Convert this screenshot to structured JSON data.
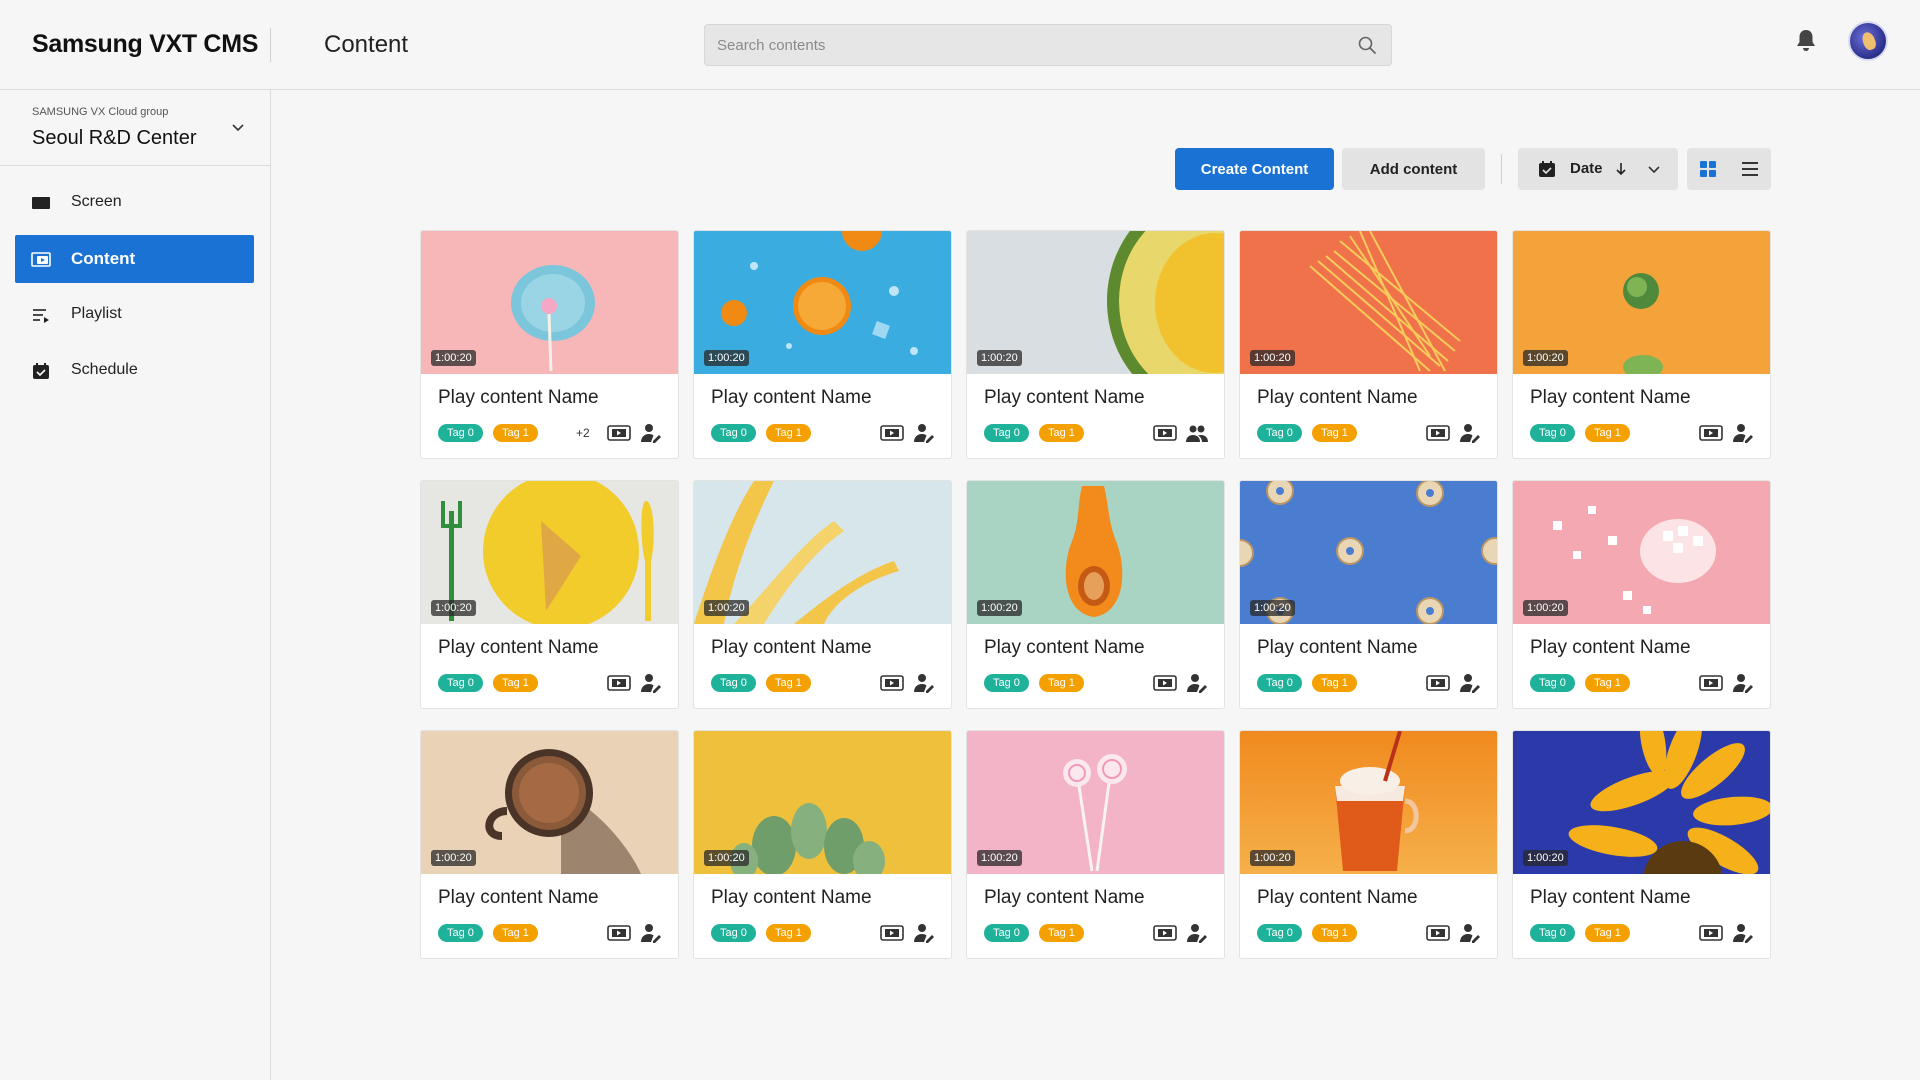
{
  "header": {
    "logo": "Samsung VXT CMS",
    "title": "Content",
    "search_placeholder": "Search contents"
  },
  "sidebar": {
    "group_label": "SAMSUNG VX Cloud group",
    "group_name": "Seoul R&D Center",
    "items": [
      {
        "label": "Screen",
        "icon": "screen-icon",
        "active": false
      },
      {
        "label": "Content",
        "icon": "content-icon",
        "active": true
      },
      {
        "label": "Playlist",
        "icon": "playlist-icon",
        "active": false
      },
      {
        "label": "Schedule",
        "icon": "schedule-icon",
        "active": false
      }
    ]
  },
  "toolbar": {
    "create_label": "Create Content",
    "add_label": "Add content",
    "sort_label": "Date",
    "sort_direction": "descending",
    "view_mode": "grid"
  },
  "colors": {
    "accent": "#1a73d4",
    "tag0": "#1fb29a",
    "tag1": "#f4a100"
  },
  "cards": [
    {
      "name": "Play content Name",
      "duration": "1:00:20",
      "tags": [
        "Tag 0",
        "Tag 1"
      ],
      "more": "+2",
      "share_icon": "user-share-icon",
      "thumb": "pink-lollipop-plate"
    },
    {
      "name": "Play content Name",
      "duration": "1:00:20",
      "tags": [
        "Tag 0",
        "Tag 1"
      ],
      "more": "",
      "share_icon": "user-share-icon",
      "thumb": "orange-slices-blue"
    },
    {
      "name": "Play content Name",
      "duration": "1:00:20",
      "tags": [
        "Tag 0",
        "Tag 1"
      ],
      "more": "",
      "share_icon": "users-group-icon",
      "thumb": "avocado-half"
    },
    {
      "name": "Play content Name",
      "duration": "1:00:20",
      "tags": [
        "Tag 0",
        "Tag 1"
      ],
      "more": "",
      "share_icon": "user-share-icon",
      "thumb": "spaghetti-orange"
    },
    {
      "name": "Play content Name",
      "duration": "1:00:20",
      "tags": [
        "Tag 0",
        "Tag 1"
      ],
      "more": "",
      "share_icon": "user-share-icon",
      "thumb": "brussels-sprout-orange"
    },
    {
      "name": "Play content Name",
      "duration": "1:00:20",
      "tags": [
        "Tag 0",
        "Tag 1"
      ],
      "more": "",
      "share_icon": "user-share-icon",
      "thumb": "waffle-yellow-plate"
    },
    {
      "name": "Play content Name",
      "duration": "1:00:20",
      "tags": [
        "Tag 0",
        "Tag 1"
      ],
      "more": "",
      "share_icon": "user-share-icon",
      "thumb": "yellow-leaves"
    },
    {
      "name": "Play content Name",
      "duration": "1:00:20",
      "tags": [
        "Tag 0",
        "Tag 1"
      ],
      "more": "",
      "share_icon": "user-share-icon",
      "thumb": "butternut-squash"
    },
    {
      "name": "Play content Name",
      "duration": "1:00:20",
      "tags": [
        "Tag 0",
        "Tag 1"
      ],
      "more": "",
      "share_icon": "user-share-icon",
      "thumb": "donuts-blue"
    },
    {
      "name": "Play content Name",
      "duration": "1:00:20",
      "tags": [
        "Tag 0",
        "Tag 1"
      ],
      "more": "",
      "share_icon": "user-share-icon",
      "thumb": "marshmallows-pink"
    },
    {
      "name": "Play content Name",
      "duration": "1:00:20",
      "tags": [
        "Tag 0",
        "Tag 1"
      ],
      "more": "",
      "share_icon": "user-share-icon",
      "thumb": "coffee-mug"
    },
    {
      "name": "Play content Name",
      "duration": "1:00:20",
      "tags": [
        "Tag 0",
        "Tag 1"
      ],
      "more": "",
      "share_icon": "user-share-icon",
      "thumb": "cactus-yellow"
    },
    {
      "name": "Play content Name",
      "duration": "1:00:20",
      "tags": [
        "Tag 0",
        "Tag 1"
      ],
      "more": "",
      "share_icon": "user-share-icon",
      "thumb": "lollipops-pink"
    },
    {
      "name": "Play content Name",
      "duration": "1:00:20",
      "tags": [
        "Tag 0",
        "Tag 1"
      ],
      "more": "",
      "share_icon": "user-share-icon",
      "thumb": "iced-drink-orange"
    },
    {
      "name": "Play content Name",
      "duration": "1:00:20",
      "tags": [
        "Tag 0",
        "Tag 1"
      ],
      "more": "",
      "share_icon": "user-share-icon",
      "thumb": "sunflower-blue"
    }
  ]
}
